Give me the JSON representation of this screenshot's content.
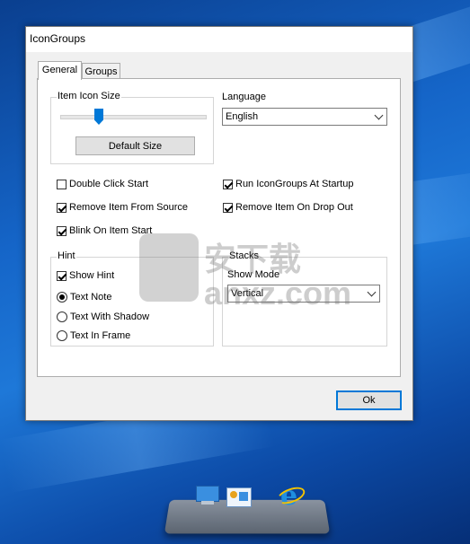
{
  "window": {
    "title": "IconGroups"
  },
  "tabs": [
    {
      "label": "General"
    },
    {
      "label": "Groups"
    }
  ],
  "item_icon_size": {
    "label": "Item Icon Size",
    "slider_value_percent": 27,
    "default_button": "Default Size"
  },
  "language": {
    "label": "Language",
    "value": "English"
  },
  "options": {
    "double_click_start": {
      "label": "Double Click Start",
      "checked": false
    },
    "run_at_startup": {
      "label": "Run IconGroups At Startup",
      "checked": true
    },
    "remove_from_source": {
      "label": "Remove Item From Source",
      "checked": true
    },
    "remove_on_drop_out": {
      "label": "Remove Item On Drop Out",
      "checked": true
    },
    "blink_on_start": {
      "label": "Blink On Item Start",
      "checked": true
    }
  },
  "hint": {
    "label": "Hint",
    "show_hint": {
      "label": "Show Hint",
      "checked": true
    },
    "radios": [
      {
        "label": "Text Note",
        "selected": true
      },
      {
        "label": "Text With Shadow",
        "selected": false
      },
      {
        "label": "Text In Frame",
        "selected": false
      }
    ]
  },
  "stacks": {
    "label": "Stacks",
    "show_mode_label": "Show Mode",
    "show_mode_value": "Vertical"
  },
  "ok_button": "Ok",
  "watermark": "安下载 anxz.com",
  "colors": {
    "accent": "#0078d7",
    "desktop": "#1565c8"
  },
  "dock_icons": [
    "computer-icon",
    "control-panel-icon",
    "internet-explorer-icon"
  ]
}
